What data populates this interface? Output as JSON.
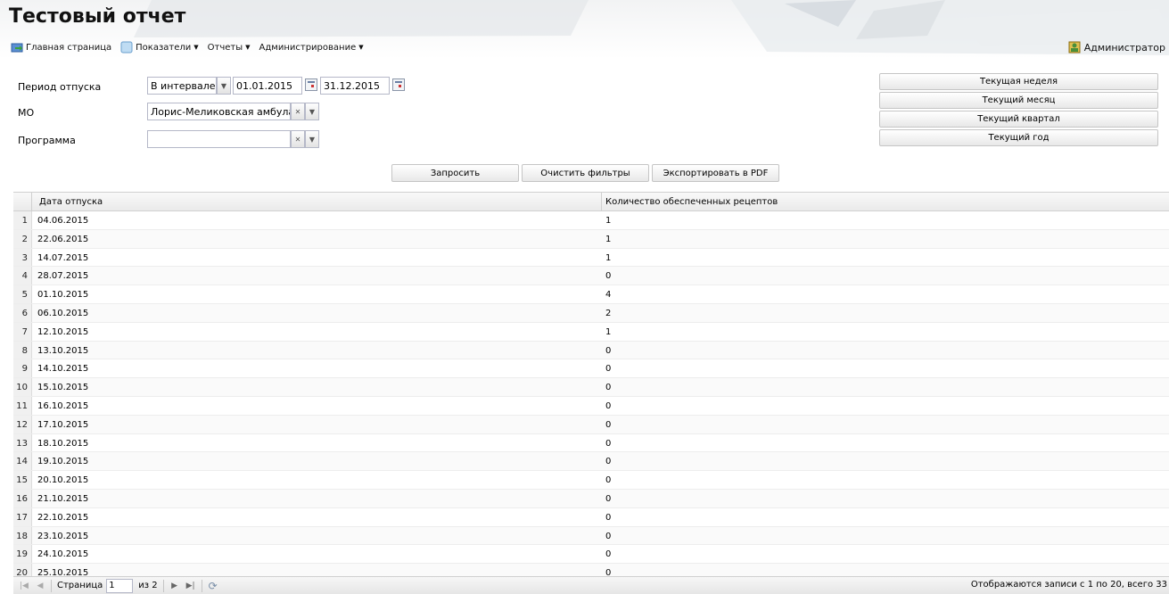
{
  "app": {
    "title": "Тестовый отчет"
  },
  "menu": {
    "home": "Главная страница",
    "indicators": "Показатели",
    "reports": "Отчеты",
    "admin_menu": "Администрирование",
    "user": "Администратор"
  },
  "filters": {
    "period_label": "Период отпуска",
    "period_mode": "В интервале",
    "date_from": "01.01.2015",
    "date_to": "31.12.2015",
    "mo_label": "МО",
    "mo_value": "Лорис-Меликовская амбулат",
    "program_label": "Программа",
    "program_value": ""
  },
  "quick_ranges": [
    "Текущая неделя",
    "Текущий месяц",
    "Текущий квартал",
    "Текущий год"
  ],
  "actions": {
    "query": "Запросить",
    "clear": "Очистить фильтры",
    "export": "Экспортировать в PDF"
  },
  "grid": {
    "columns": [
      "Дата отпуска",
      "Количество обеспеченных рецептов"
    ],
    "rows": [
      {
        "num": "1",
        "date": "04.06.2015",
        "count": "1"
      },
      {
        "num": "2",
        "date": "22.06.2015",
        "count": "1"
      },
      {
        "num": "3",
        "date": "14.07.2015",
        "count": "1"
      },
      {
        "num": "4",
        "date": "28.07.2015",
        "count": "0"
      },
      {
        "num": "5",
        "date": "01.10.2015",
        "count": "4"
      },
      {
        "num": "6",
        "date": "06.10.2015",
        "count": "2"
      },
      {
        "num": "7",
        "date": "12.10.2015",
        "count": "1"
      },
      {
        "num": "8",
        "date": "13.10.2015",
        "count": "0"
      },
      {
        "num": "9",
        "date": "14.10.2015",
        "count": "0"
      },
      {
        "num": "10",
        "date": "15.10.2015",
        "count": "0"
      },
      {
        "num": "11",
        "date": "16.10.2015",
        "count": "0"
      },
      {
        "num": "12",
        "date": "17.10.2015",
        "count": "0"
      },
      {
        "num": "13",
        "date": "18.10.2015",
        "count": "0"
      },
      {
        "num": "14",
        "date": "19.10.2015",
        "count": "0"
      },
      {
        "num": "15",
        "date": "20.10.2015",
        "count": "0"
      },
      {
        "num": "16",
        "date": "21.10.2015",
        "count": "0"
      },
      {
        "num": "17",
        "date": "22.10.2015",
        "count": "0"
      },
      {
        "num": "18",
        "date": "23.10.2015",
        "count": "0"
      },
      {
        "num": "19",
        "date": "24.10.2015",
        "count": "0"
      },
      {
        "num": "20",
        "date": "25.10.2015",
        "count": "0"
      }
    ]
  },
  "pager": {
    "page_label": "Страница",
    "page": "1",
    "of": "из 2",
    "status": "Отображаются записи с 1 по 20, всего 33"
  },
  "icons": {
    "home": "home-icon",
    "indicators": "indicators-icon",
    "user": "user-icon",
    "first": "first-page-icon",
    "prev": "prev-page-icon",
    "next": "next-page-icon",
    "last": "last-page-icon",
    "refresh": "refresh-icon"
  }
}
